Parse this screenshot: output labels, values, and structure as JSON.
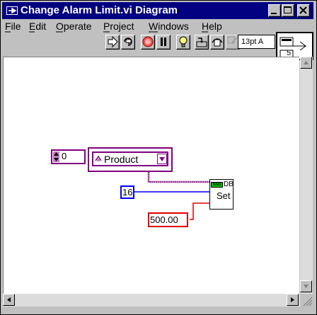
{
  "window": {
    "title": "Change Alarm Limit.vi Diagram"
  },
  "menu": {
    "items": [
      {
        "label": "File",
        "key": "F"
      },
      {
        "label": "Edit",
        "key": "E"
      },
      {
        "label": "Operate",
        "key": "O"
      },
      {
        "label": "Project",
        "key": "P"
      },
      {
        "label": "Windows",
        "key": "W"
      },
      {
        "label": "Help",
        "key": "H"
      }
    ]
  },
  "toolbar": {
    "font_value": "13pt A",
    "icons": [
      "run-arrow-icon",
      "run-continuously-icon",
      "abort-icon",
      "pause-icon",
      "highlight-execution-icon",
      "step-into-icon",
      "step-over-icon",
      "step-out-icon"
    ]
  },
  "connector_pane": {
    "value": "5"
  },
  "diagram": {
    "index_value": "0",
    "ring_label": "Product",
    "tag_number": "16",
    "node_badge": "TAG",
    "node_db": "DB",
    "node_set": "Set",
    "limit_value": "500.00"
  },
  "colors": {
    "titlebar": "#000080",
    "purple_wire": "#800080",
    "blue_constant": "#0000ff",
    "red_constant": "#e00000"
  }
}
